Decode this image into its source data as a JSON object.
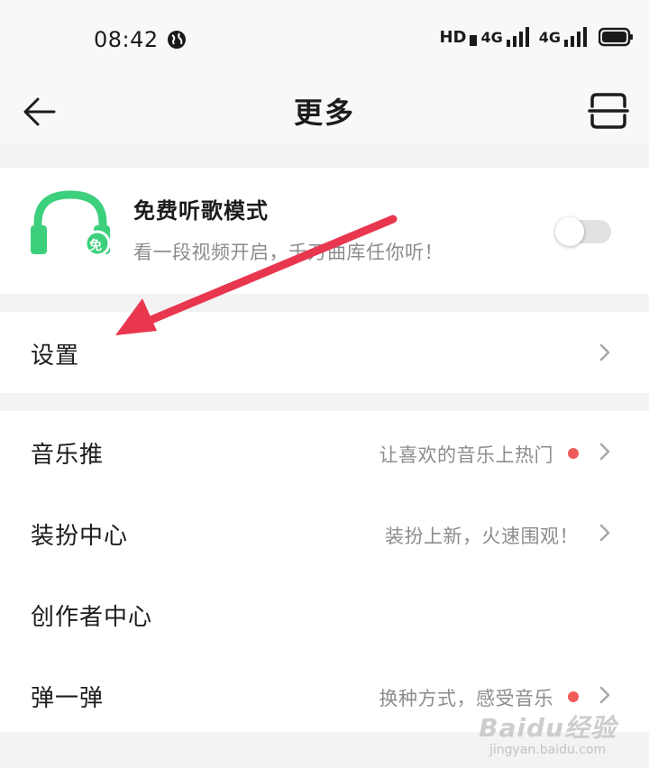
{
  "status_bar": {
    "time": "08:42",
    "network_hd": "HD",
    "signal1": "4G",
    "signal2": "4G",
    "icons": [
      "globe-icon",
      "signal-icon",
      "signal-icon",
      "battery-icon"
    ]
  },
  "header": {
    "title": "更多",
    "back_icon": "arrow-left-icon",
    "scan_icon": "scan-icon"
  },
  "free_mode": {
    "title": "免费听歌模式",
    "subtitle": "看一段视频开启，千万曲库任你听！",
    "badge": "免",
    "enabled": false,
    "accent_color": "#3ccf7c"
  },
  "settings": {
    "label": "设置"
  },
  "menu_items": [
    {
      "label": "音乐推",
      "desc": "让喜欢的音乐上热门",
      "dot": true
    },
    {
      "label": "装扮中心",
      "desc": "装扮上新，火速围观！",
      "dot": false
    },
    {
      "label": "创作者中心",
      "desc": "",
      "dot": false
    },
    {
      "label": "弹一弹",
      "desc": "换种方式，感受音乐",
      "dot": true
    }
  ],
  "annotation": {
    "arrow_color": "#e8364f"
  },
  "watermark": {
    "logo": "Baidu经验",
    "url": "jingyan.baidu.com"
  }
}
